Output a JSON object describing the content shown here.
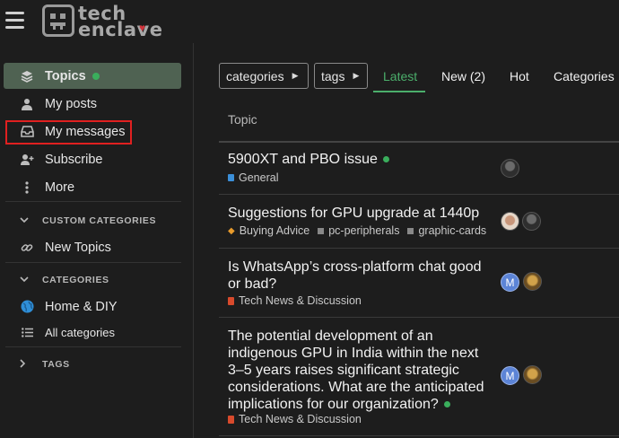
{
  "header": {
    "logo_line1": "tech",
    "logo_line2": "enclave"
  },
  "sidebar": {
    "items": [
      {
        "label": "Topics",
        "icon": "layers-icon"
      },
      {
        "label": "My posts",
        "icon": "user-icon"
      },
      {
        "label": "My messages",
        "icon": "inbox-icon"
      },
      {
        "label": "Subscribe",
        "icon": "user-plus-icon"
      },
      {
        "label": "More",
        "icon": "vertical-ellipsis-icon"
      }
    ],
    "custom_categories_heading": "CUSTOM CATEGORIES",
    "custom_items": [
      {
        "label": "New Topics",
        "icon": "link-icon"
      }
    ],
    "categories_heading": "CATEGORIES",
    "category_items": [
      {
        "label": "Home & DIY",
        "icon": "globe-icon"
      },
      {
        "label": "All categories",
        "icon": "list-icon"
      }
    ],
    "tags_heading": "TAGS"
  },
  "filters": {
    "categories_label": "categories",
    "tags_label": "tags"
  },
  "tabs": [
    "Latest",
    "New (2)",
    "Hot",
    "Categories"
  ],
  "table": {
    "topic_header": "Topic"
  },
  "topics": [
    {
      "title": "5900XT and PBO issue",
      "category": "General",
      "category_color": "#3b8fd9",
      "tags": []
    },
    {
      "title": "Suggestions for GPU upgrade at 1440p",
      "category": "Buying Advice",
      "category_color": "#e89b2c",
      "tags": [
        "pc-peripherals",
        "graphic-cards"
      ]
    },
    {
      "title_line1": "Is WhatsApp’s cross-platform chat good",
      "title_line2": "or bad?",
      "category": "Tech News & Discussion",
      "category_color": "#d84a2c",
      "avatar_letter": "M"
    },
    {
      "title_line1": "The potential development of an",
      "title_line2": "indigenous GPU in India within the next",
      "title_line3": "3–5 years raises significant strategic",
      "title_line4": "considerations. What are the anticipated",
      "title_line5": "implications for our organization?",
      "category": "Tech News & Discussion",
      "category_color": "#d84a2c",
      "avatar_letter": "M"
    }
  ],
  "colors": {
    "accent_green": "#4bae6b",
    "highlight_red": "#e02020",
    "active_item_bg": "#4f6252"
  }
}
